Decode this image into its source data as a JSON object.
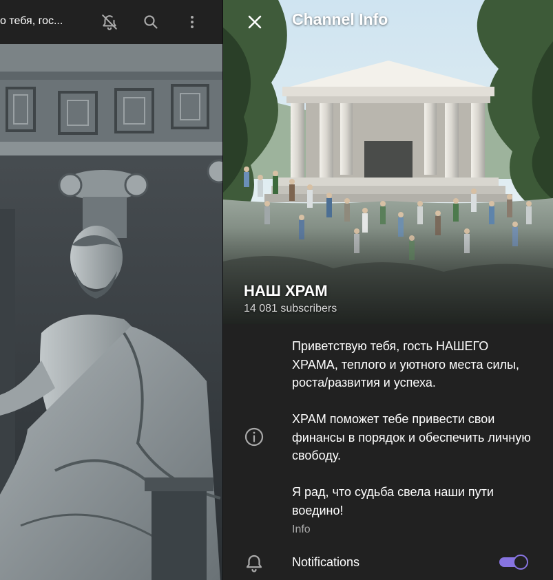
{
  "chat": {
    "title": "о тебя, гос..."
  },
  "info_panel": {
    "title": "Channel Info",
    "channel_name": "НАШ ХРАМ",
    "subscribers": "14 081 subscribers",
    "description": "Приветствую тебя, гость НАШЕГО ХРАМА, теплого и уютного места силы, роста/развития и успеха.\n\nХРАМ поможет тебе привести свои финансы в порядок и обеспечить личную свободу.\n\nЯ рад, что судьба свела наши пути воедино!",
    "description_label": "Info",
    "notifications_label": "Notifications",
    "notifications_on": true
  },
  "icons": {
    "mute": "bell-off-icon",
    "search": "search-icon",
    "more": "more-vertical-icon",
    "close": "close-icon",
    "info": "info-icon",
    "notifications": "bell-icon"
  },
  "colors": {
    "background": "#212121",
    "accent": "#8774e1",
    "secondary_text": "#aaaaaa"
  }
}
